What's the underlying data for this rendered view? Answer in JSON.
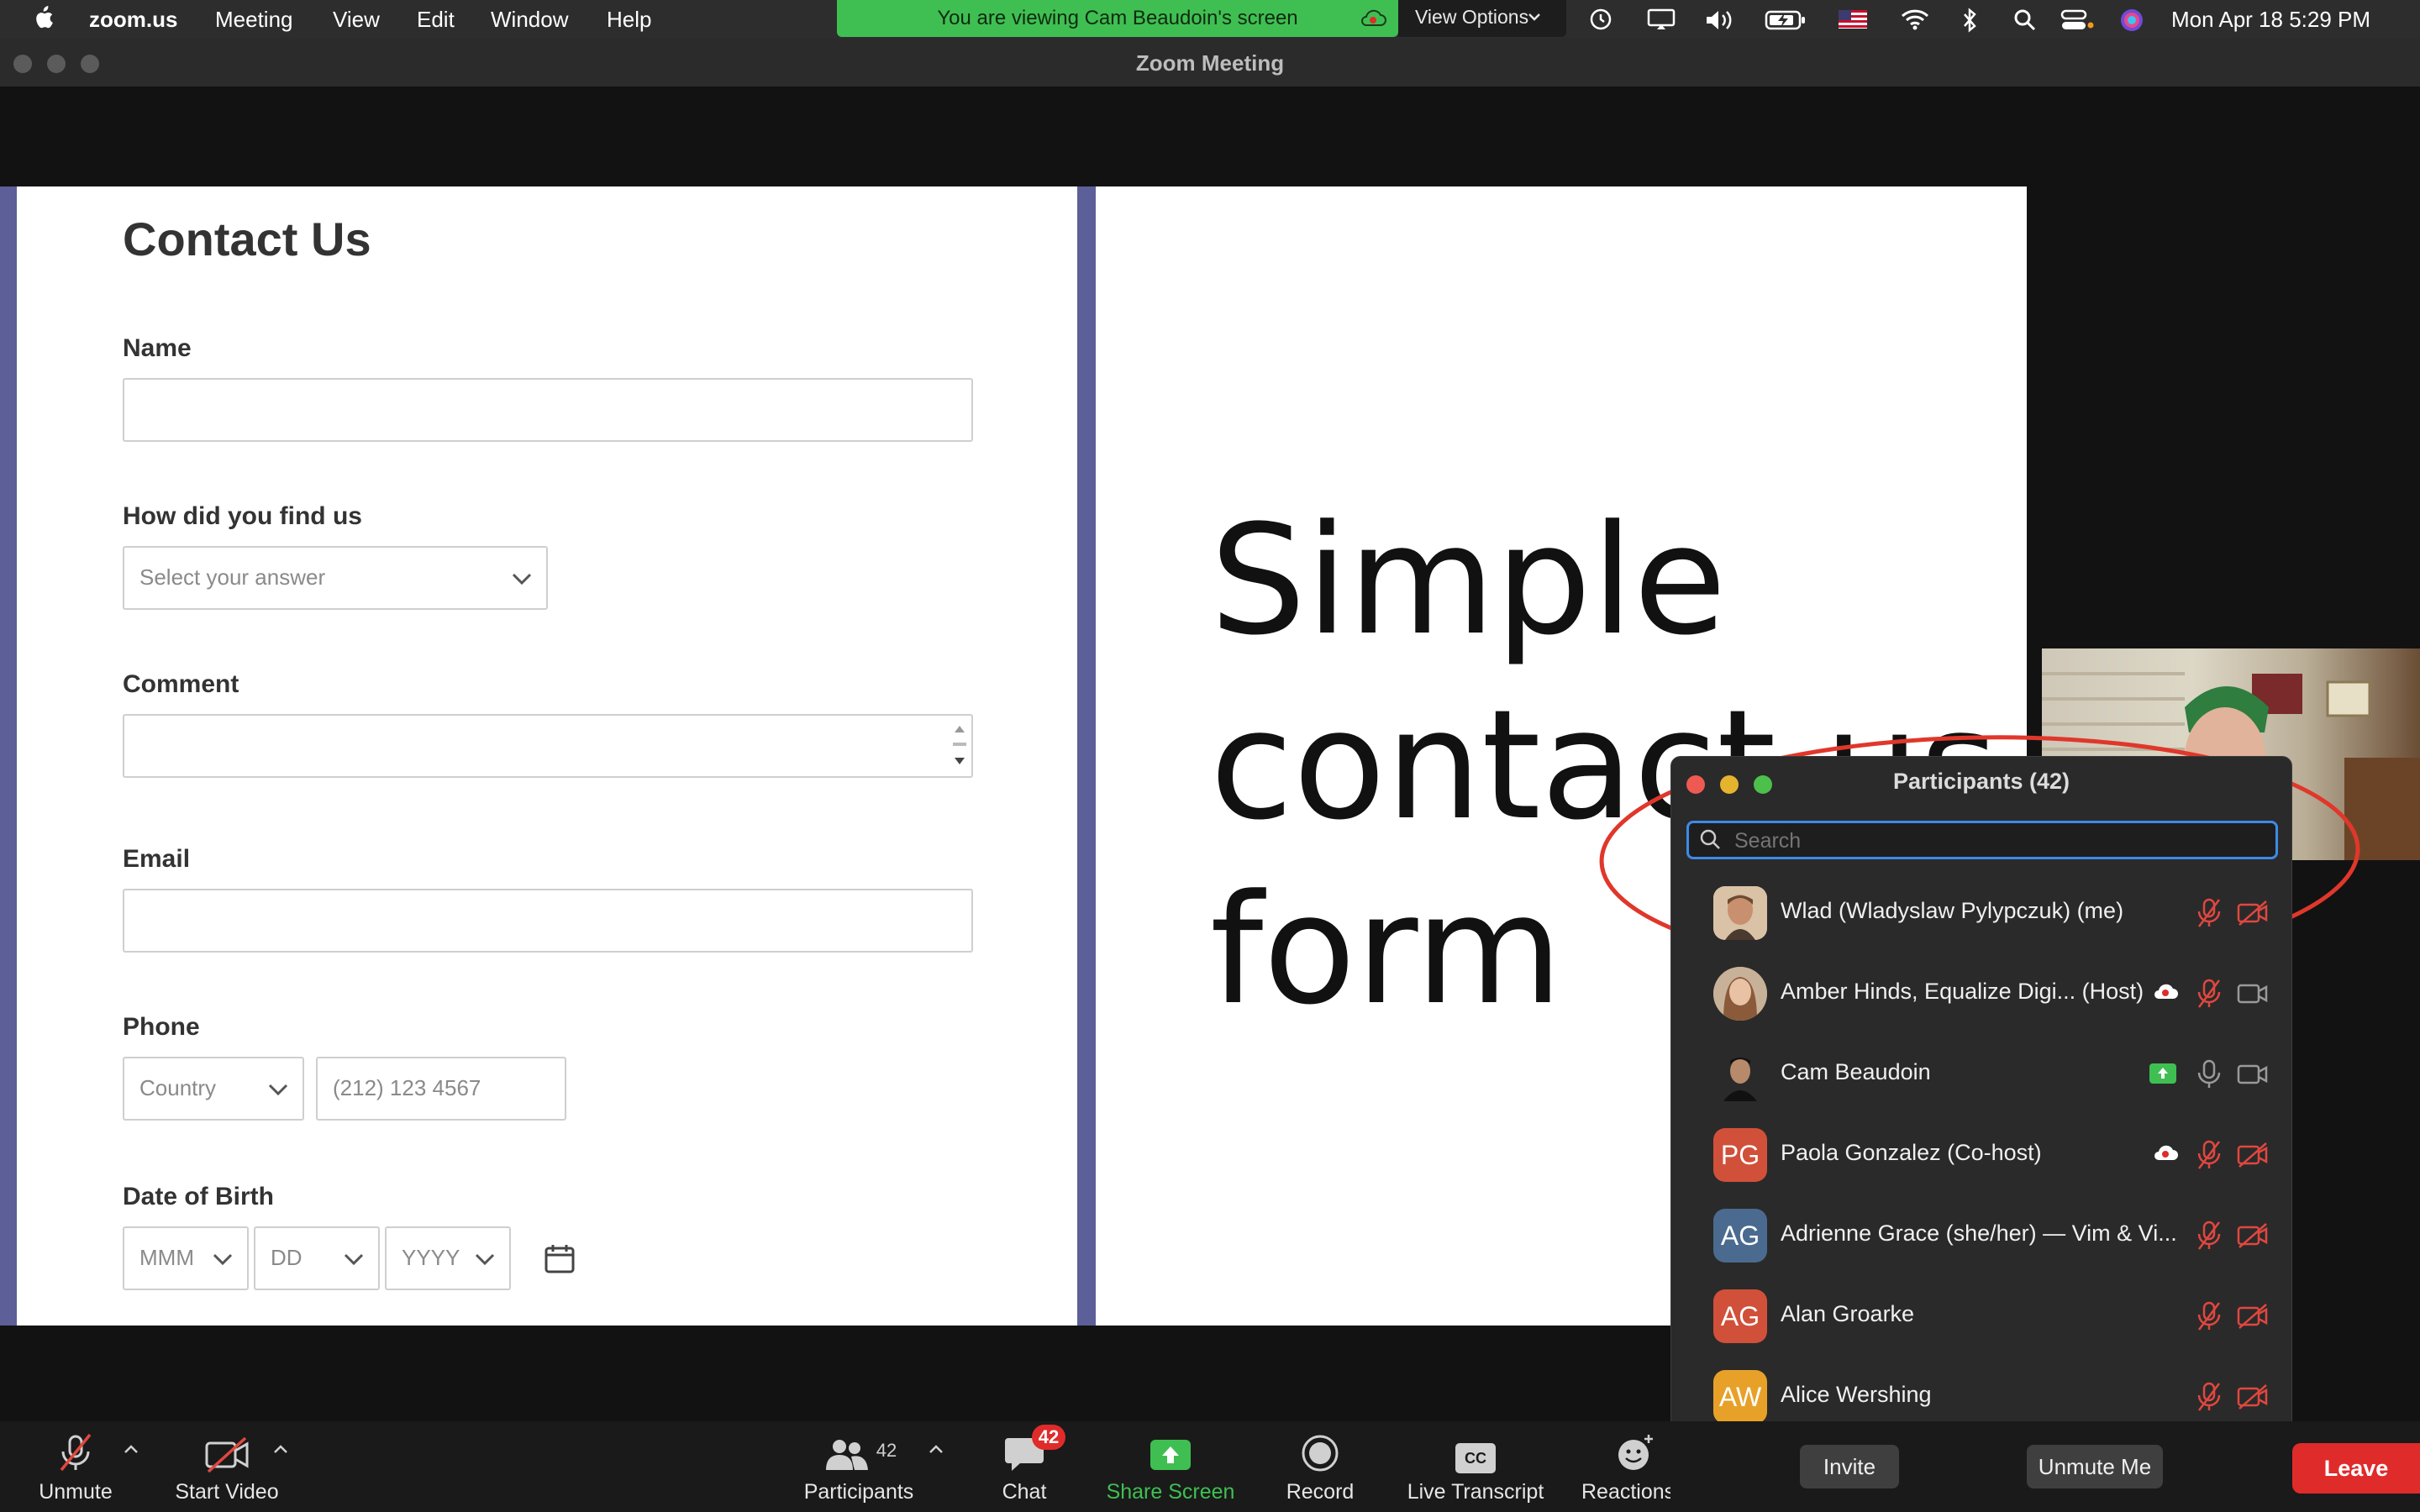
{
  "menubar": {
    "app": "zoom.us",
    "items": [
      "Meeting",
      "View",
      "Edit",
      "Window",
      "Help"
    ],
    "banner": "You are viewing Cam Beaudoin's screen",
    "view_options": "View Options",
    "datetime": "Mon Apr 18  5:29 PM"
  },
  "window": {
    "title": "Zoom Meeting"
  },
  "shared_screen": {
    "form_title": "Contact Us",
    "fields": {
      "name_label": "Name",
      "find_label": "How did you find us",
      "find_placeholder": "Select your answer",
      "comment_label": "Comment",
      "email_label": "Email",
      "phone_label": "Phone",
      "country_placeholder": "Country",
      "phone_placeholder": "(212) 123 4567",
      "dob_label": "Date of Birth",
      "month_placeholder": "MMM",
      "day_placeholder": "DD",
      "year_placeholder": "YYYY"
    },
    "heading_lines": [
      "Simple",
      "contact us",
      "form"
    ]
  },
  "participants_panel": {
    "title": "Participants (42)",
    "search_placeholder": "Search",
    "participants": [
      {
        "name": "Wlad (Wladyslaw Pylypczuk) (me)",
        "initials": "",
        "avatar_color": "#c9a27e",
        "mic": "muted",
        "video": "off"
      },
      {
        "name": "Amber Hinds, Equalize Digi...  (Host)",
        "initials": "",
        "avatar_color": "#b08b6e",
        "mic": "muted",
        "video": "on",
        "badge": "cloud-record"
      },
      {
        "name": "Cam Beaudoin",
        "initials": "",
        "avatar_color": "#333333",
        "mic": "on",
        "video": "on",
        "badge": "sharing"
      },
      {
        "name": "Paola Gonzalez (Co-host)",
        "initials": "PG",
        "avatar_color": "#d1503a",
        "mic": "muted",
        "video": "off",
        "badge": "cloud-record"
      },
      {
        "name": "Adrienne Grace (she/her) — Vim & Vi...",
        "initials": "AG",
        "avatar_color": "#4a6b8f",
        "mic": "muted",
        "video": "off"
      },
      {
        "name": "Alan Groarke",
        "initials": "AG",
        "avatar_color": "#d1503a",
        "mic": "muted",
        "video": "off"
      },
      {
        "name": "Alice Wershing",
        "initials": "AW",
        "avatar_color": "#e8a128",
        "mic": "muted",
        "video": "off"
      }
    ],
    "invite_label": "Invite",
    "unmute_label": "Unmute Me"
  },
  "toolbar": {
    "unmute": "Unmute",
    "start_video": "Start Video",
    "participants": "Participants",
    "participants_count": "42",
    "chat": "Chat",
    "chat_badge": "42",
    "share_screen": "Share Screen",
    "record": "Record",
    "live_transcript": "Live Transcript",
    "reactions": "Reactions",
    "leave": "Leave",
    "cc_glyph": "CC"
  },
  "colors": {
    "share_green": "#3fbf52",
    "leave_red": "#e02b2b",
    "accent_blue": "#3d8be6",
    "muted_red": "#e0473f",
    "form_bar": "#5d5f99",
    "annotation_red": "#e0372b"
  },
  "icons": {
    "apple": "apple-icon",
    "record_indicator": "cloud-record-icon"
  }
}
